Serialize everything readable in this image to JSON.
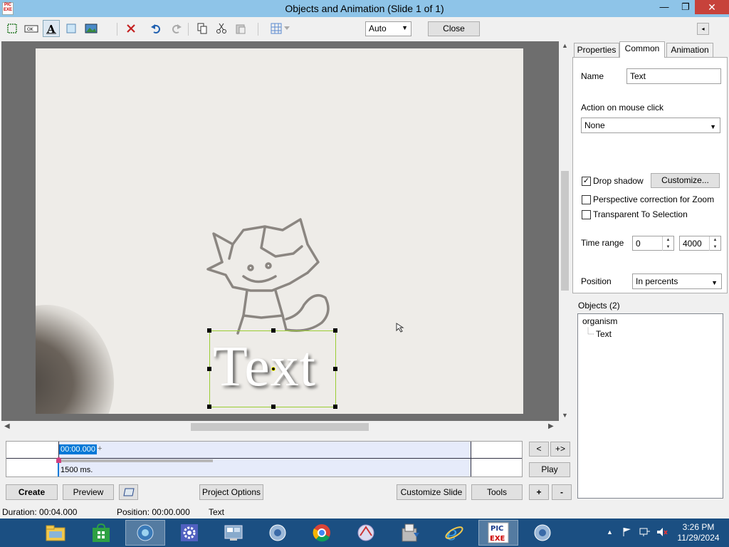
{
  "window": {
    "title": "Objects and Animation  (Slide 1 of 1)",
    "app_icon_text": "PIC EXE",
    "minimize": "—",
    "maximize": "❐",
    "close": "✕"
  },
  "toolbar": {
    "zoom_value": "Auto",
    "close_label": "Close",
    "collapse_arrow": "◂"
  },
  "canvas": {
    "selected_text": "Text"
  },
  "timeline": {
    "current_time": "00:00.000",
    "plus_marker": "+",
    "duration_label": "1500 ms.",
    "prev_label": "<",
    "next_label": "+>",
    "play_label": "Play"
  },
  "buttons": {
    "create": "Create",
    "preview": "Preview",
    "project_options": "Project Options",
    "customize_slide": "Customize Slide",
    "tools": "Tools",
    "add": "+",
    "remove": "-"
  },
  "status": {
    "duration": "Duration:  00:04.000",
    "position": "Position:  00:00.000",
    "object": "Text"
  },
  "panel": {
    "tabs": [
      "Properties",
      "Common",
      "Animation"
    ],
    "active_tab": "Common",
    "name_label": "Name",
    "name_value": "Text",
    "action_label": "Action on mouse click",
    "action_value": "None",
    "drop_shadow_label": "Drop shadow",
    "drop_shadow_checked": true,
    "customize_label": "Customize...",
    "perspective_label": "Perspective correction for Zoom",
    "transparent_label": "Transparent To Selection",
    "time_range_label": "Time range",
    "time_range_start": "0",
    "time_range_end": "4000",
    "position_label": "Position",
    "position_value": "In percents"
  },
  "objects": {
    "header": "Objects (2)",
    "items": [
      {
        "label": "organism",
        "level": 0
      },
      {
        "label": "Text",
        "level": 1
      }
    ]
  },
  "taskbar": {
    "apps": [
      "file-explorer",
      "store",
      "app-3",
      "settings",
      "control-panel",
      "app-6",
      "chrome",
      "app-8",
      "installer",
      "internet-explorer",
      "picture-to-exe",
      "app-12"
    ],
    "clock_time": "3:26 PM",
    "clock_date": "11/29/2024"
  },
  "colors": {
    "titlebar": "#8ec4e8",
    "taskbar": "#1b4f82",
    "selection": "#9acd32",
    "accent": "#0078d7"
  }
}
